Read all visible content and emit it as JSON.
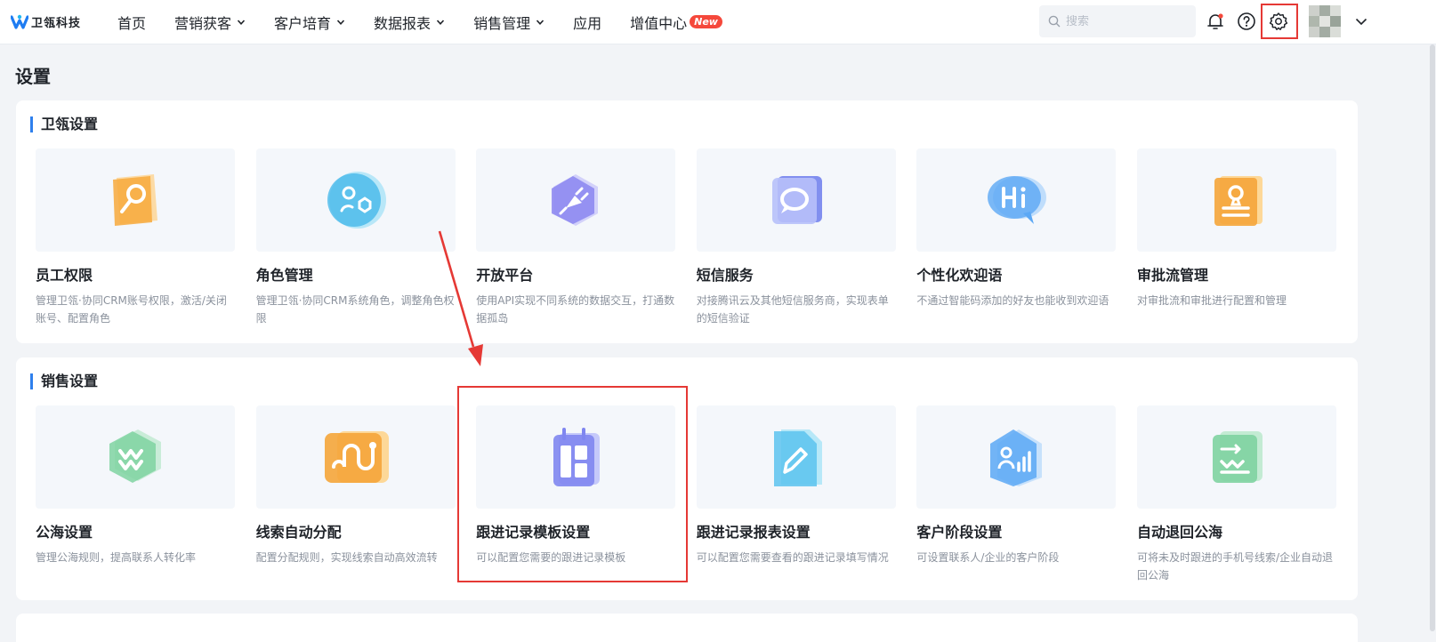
{
  "logo": {
    "text": "卫瓴科技"
  },
  "nav": {
    "items": [
      {
        "label": "首页",
        "has_dropdown": false
      },
      {
        "label": "营销获客",
        "has_dropdown": true
      },
      {
        "label": "客户培育",
        "has_dropdown": true
      },
      {
        "label": "数据报表",
        "has_dropdown": true
      },
      {
        "label": "销售管理",
        "has_dropdown": true
      },
      {
        "label": "应用",
        "has_dropdown": false
      },
      {
        "label": "增值中心",
        "has_dropdown": false,
        "badge": "New"
      }
    ]
  },
  "search": {
    "placeholder": "搜索",
    "value": ""
  },
  "header_icons": [
    "bell-icon",
    "help-icon",
    "gear-icon",
    "chevron-down-icon"
  ],
  "page": {
    "title": "设置"
  },
  "sections": [
    {
      "title": "卫瓴设置",
      "cards": [
        {
          "title": "员工权限",
          "desc": "管理卫瓴·协同CRM账号权限，激活/关闭账号、配置角色",
          "icon": "key-icon",
          "color": "#f7a93b"
        },
        {
          "title": "角色管理",
          "desc": "管理卫瓴·协同CRM系统角色，调整角色权限",
          "icon": "role-icon",
          "color": "#3fb6ea"
        },
        {
          "title": "开放平台",
          "desc": "使用API实现不同系统的数据交互，打通数据孤岛",
          "icon": "plug-icon",
          "color": "#8b86f0"
        },
        {
          "title": "短信服务",
          "desc": "对接腾讯云及其他短信服务商，实现表单的短信验证",
          "icon": "chat-icon",
          "color": "#8d9cf4"
        },
        {
          "title": "个性化欢迎语",
          "desc": "不通过智能码添加的好友也能收到欢迎语",
          "icon": "hi-icon",
          "color": "#5ba8f5"
        },
        {
          "title": "审批流管理",
          "desc": "对审批流和审批进行配置和管理",
          "icon": "stamp-icon",
          "color": "#f5a53a"
        }
      ]
    },
    {
      "title": "销售设置",
      "cards": [
        {
          "title": "公海设置",
          "desc": "管理公海规则，提高联系人转化率",
          "icon": "sea-icon",
          "color": "#5cc38a"
        },
        {
          "title": "线索自动分配",
          "desc": "配置分配规则，实现线索自动高效流转",
          "icon": "route-icon",
          "color": "#f5a53a"
        },
        {
          "title": "跟进记录模板设置",
          "desc": "可以配置您需要的跟进记录模板",
          "icon": "calendar-icon",
          "color": "#7f86f0"
        },
        {
          "title": "跟进记录报表设置",
          "desc": "可以配置您需要查看的跟进记录填写情况",
          "icon": "edit-doc-icon",
          "color": "#5cc3ee"
        },
        {
          "title": "客户阶段设置",
          "desc": "可设置联系人/企业的客户阶段",
          "icon": "stage-icon",
          "color": "#5ba8f5"
        },
        {
          "title": "自动退回公海",
          "desc": "可将未及时跟进的手机号线索/企业自动退回公海",
          "icon": "return-icon",
          "color": "#5cc38a"
        }
      ]
    }
  ],
  "colors": {
    "accent": "#2f80ed",
    "annotation": "#e53935",
    "new_badge": "#f5483b"
  }
}
